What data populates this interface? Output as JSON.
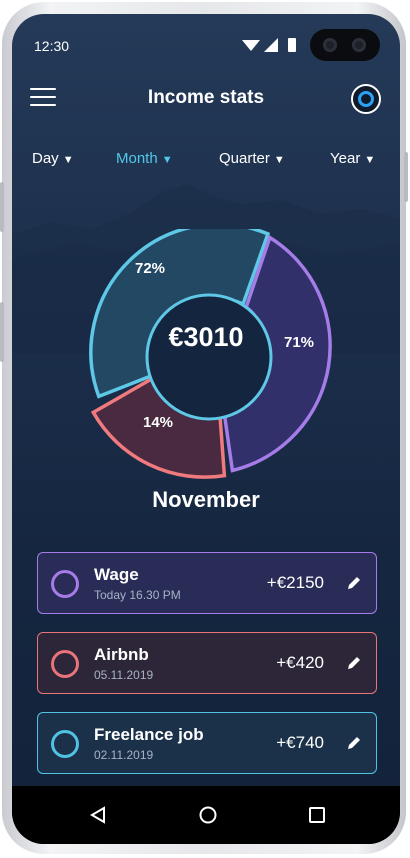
{
  "status_bar": {
    "time": "12:30"
  },
  "header": {
    "title": "Income stats"
  },
  "periods": [
    {
      "label": "Day",
      "active": false
    },
    {
      "label": "Month",
      "active": true
    },
    {
      "label": "Quarter",
      "active": false
    },
    {
      "label": "Year",
      "active": false
    }
  ],
  "summary": {
    "total": "€3010",
    "month": "November",
    "segments": [
      {
        "label": "72%",
        "color": "#5ec8e6"
      },
      {
        "label": "71%",
        "color": "#a67de8"
      },
      {
        "label": "14%",
        "color": "#f07a7e"
      }
    ]
  },
  "transactions": [
    {
      "name": "Wage",
      "date": "Today 16.30 PM",
      "amount": "+€2150",
      "color": "#a67de8"
    },
    {
      "name": "Airbnb",
      "date": "05.11.2019",
      "amount": "+€420",
      "color": "#e9747a"
    },
    {
      "name": "Freelance job",
      "date": "02.11.2019",
      "amount": "+€740",
      "color": "#4fc3e4"
    }
  ],
  "icons": {
    "menu": "hamburger-menu-icon",
    "profile": "profile-avatar-icon",
    "edit": "pencil-icon",
    "nav_back": "back-triangle-icon",
    "nav_home": "home-circle-icon",
    "nav_recents": "recents-square-icon"
  }
}
